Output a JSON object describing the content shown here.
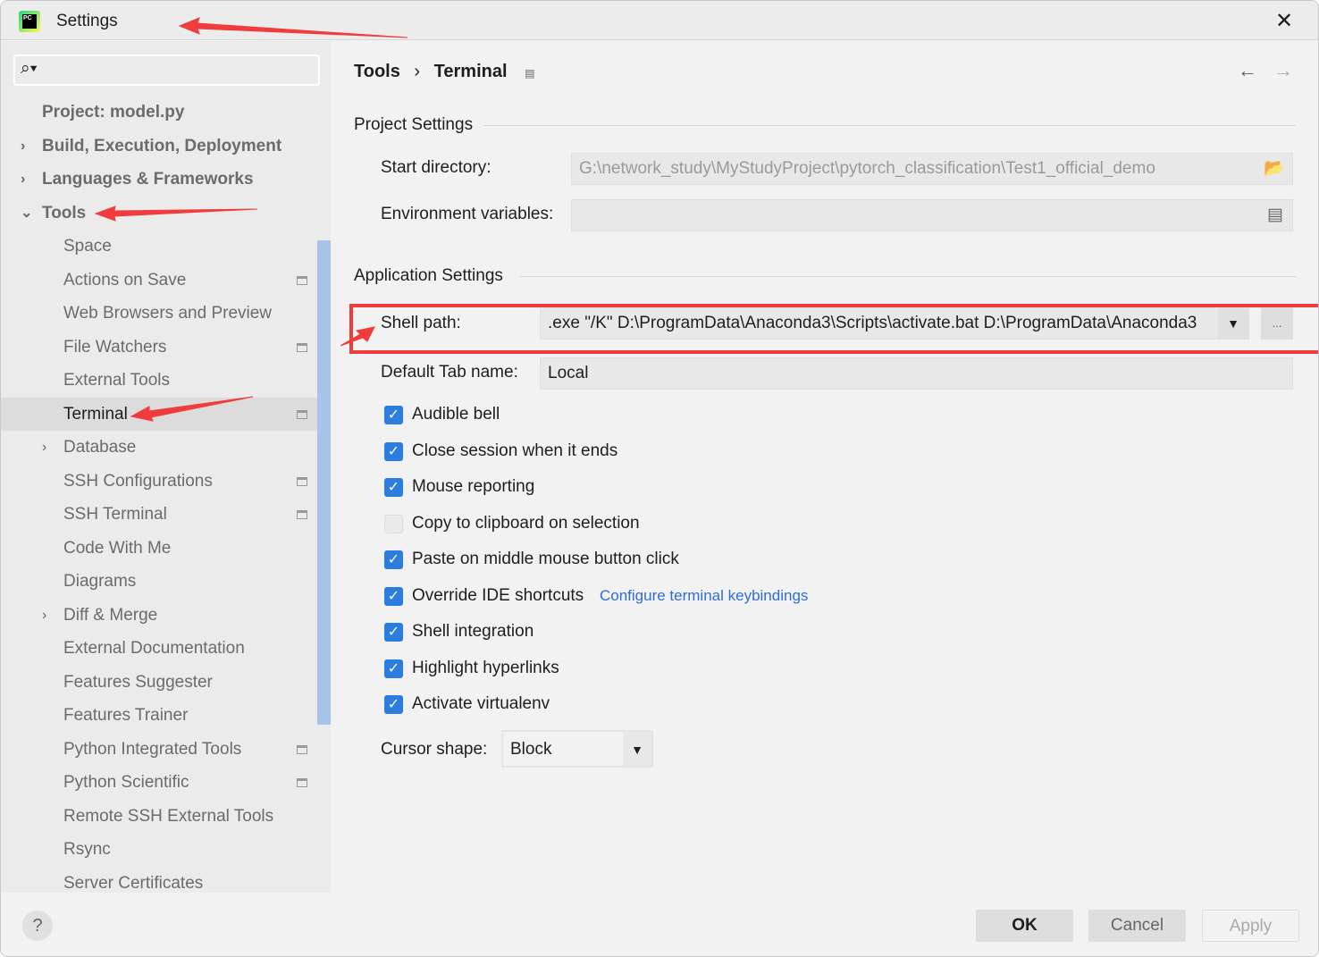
{
  "window": {
    "title": "Settings",
    "close": "✕"
  },
  "search": {
    "placeholder": "",
    "icon": "search-icon"
  },
  "sidebar": {
    "items": [
      {
        "label": "Project: model.py",
        "level": 0,
        "bold": true
      },
      {
        "label": "Build, Execution, Deployment",
        "level": 0,
        "bold": true,
        "chev": "›"
      },
      {
        "label": "Languages & Frameworks",
        "level": 0,
        "bold": true,
        "chev": "›"
      },
      {
        "label": "Tools",
        "level": 0,
        "bold": true,
        "chev": "⌄"
      },
      {
        "label": "Space",
        "level": 1
      },
      {
        "label": "Actions on Save",
        "level": 1,
        "icon": true
      },
      {
        "label": "Web Browsers and Preview",
        "level": 1
      },
      {
        "label": "File Watchers",
        "level": 1,
        "icon": true
      },
      {
        "label": "External Tools",
        "level": 1
      },
      {
        "label": "Terminal",
        "level": 1,
        "icon": true,
        "selected": true
      },
      {
        "label": "Database",
        "level": 1,
        "chev": "›"
      },
      {
        "label": "SSH Configurations",
        "level": 1,
        "icon": true
      },
      {
        "label": "SSH Terminal",
        "level": 1,
        "icon": true
      },
      {
        "label": "Code With Me",
        "level": 1
      },
      {
        "label": "Diagrams",
        "level": 1
      },
      {
        "label": "Diff & Merge",
        "level": 1,
        "chev": "›"
      },
      {
        "label": "External Documentation",
        "level": 1
      },
      {
        "label": "Features Suggester",
        "level": 1
      },
      {
        "label": "Features Trainer",
        "level": 1
      },
      {
        "label": "Python Integrated Tools",
        "level": 1,
        "icon": true
      },
      {
        "label": "Python Scientific",
        "level": 1,
        "icon": true
      },
      {
        "label": "Remote SSH External Tools",
        "level": 1
      },
      {
        "label": "Rsync",
        "level": 1
      },
      {
        "label": "Server Certificates",
        "level": 1
      }
    ]
  },
  "breadcrumb": {
    "parent": "Tools",
    "sep": "›",
    "current": "Terminal"
  },
  "project_settings": {
    "title": "Project Settings",
    "start_dir_label": "Start directory:",
    "start_dir": "G:\\network_study\\MyStudyProject\\pytorch_classification\\Test1_official_demo",
    "env_label": "Environment variables:",
    "env": ""
  },
  "app_settings": {
    "title": "Application Settings",
    "shell_label": "Shell path:",
    "shell": ".exe \"/K\" D:\\ProgramData\\Anaconda3\\Scripts\\activate.bat D:\\ProgramData\\Anaconda3",
    "browse": "...",
    "tab_label": "Default Tab name:",
    "tab": "Local",
    "checkboxes": [
      {
        "label": "Audible bell",
        "checked": true
      },
      {
        "label": "Close session when it ends",
        "checked": true
      },
      {
        "label": "Mouse reporting",
        "checked": true
      },
      {
        "label": "Copy to clipboard on selection",
        "checked": false
      },
      {
        "label": "Paste on middle mouse button click",
        "checked": true
      },
      {
        "label": "Override IDE shortcuts",
        "checked": true
      },
      {
        "label": "Shell integration",
        "checked": true
      },
      {
        "label": "Highlight hyperlinks",
        "checked": true
      },
      {
        "label": "Activate virtualenv",
        "checked": true
      }
    ],
    "link": "Configure terminal keybindings",
    "cursor_label": "Cursor shape:",
    "cursor": "Block"
  },
  "buttons": {
    "ok": "OK",
    "cancel": "Cancel",
    "apply": "Apply",
    "help": "?"
  },
  "colors": {
    "accent": "#2b7de0",
    "annotation": "#f03c3c"
  }
}
